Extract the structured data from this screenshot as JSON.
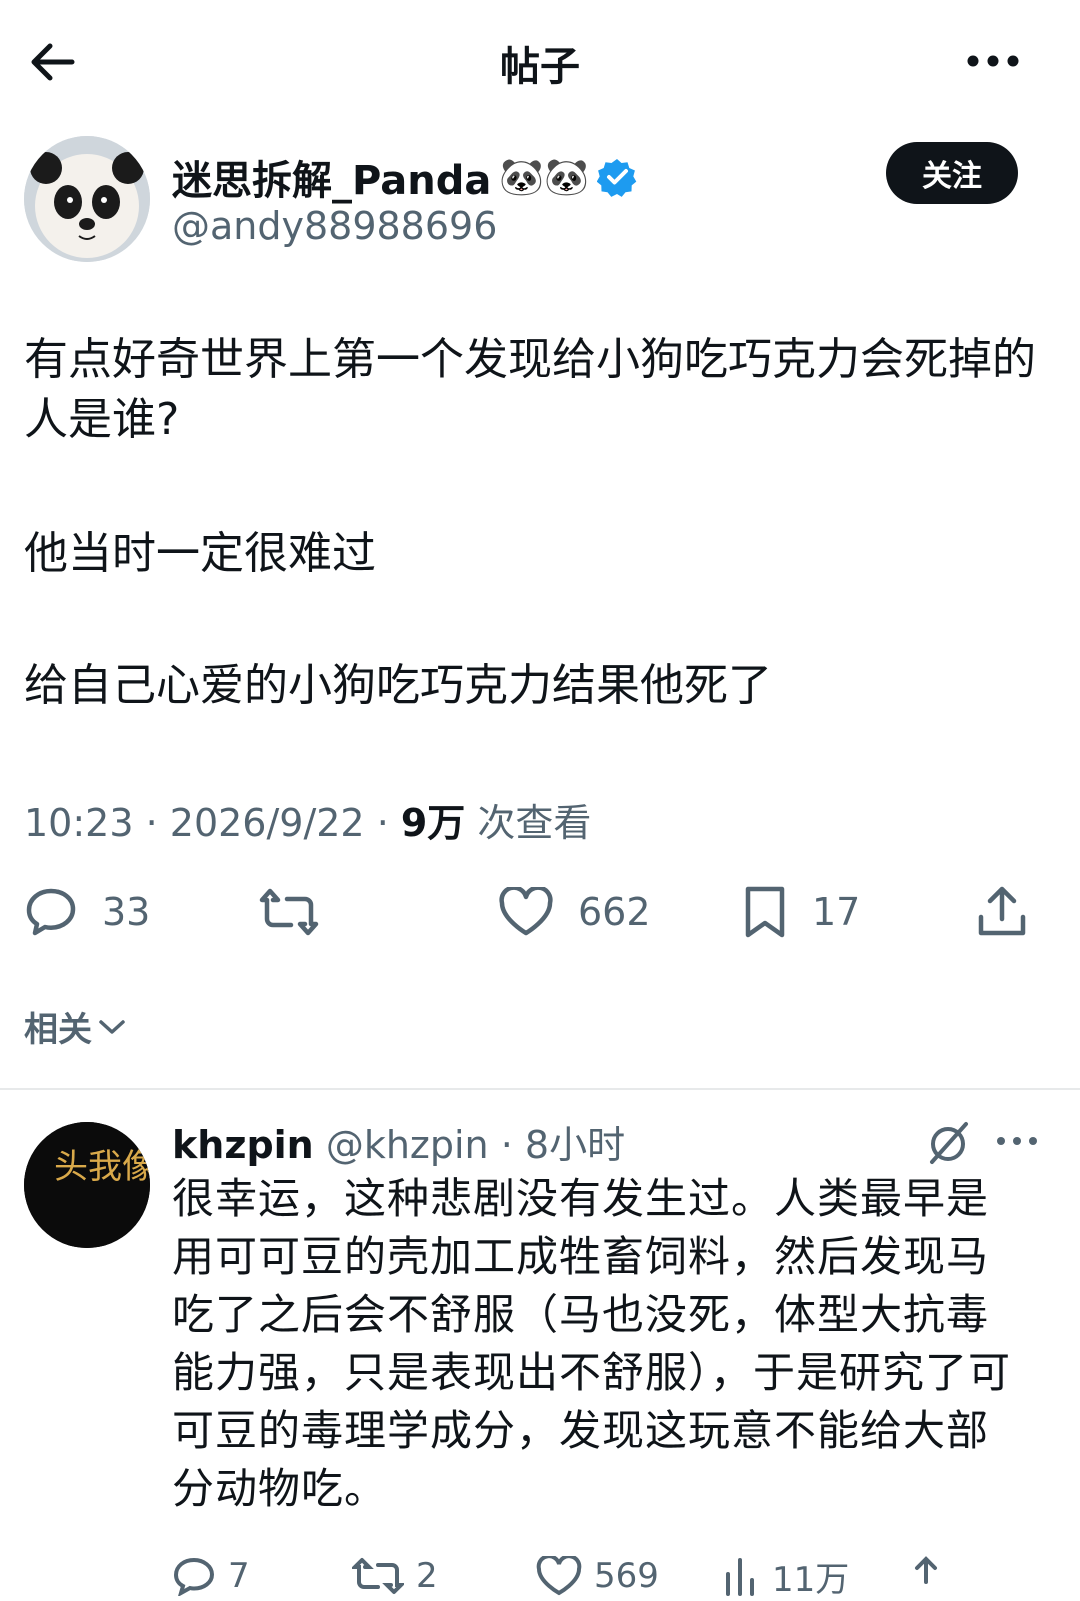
{
  "header": {
    "title": "帖子",
    "back_icon": "arrow-left-icon",
    "more_icon": "ellipsis-icon"
  },
  "post": {
    "author_name": "迷思拆解_Panda",
    "author_emojis": "🐼🐼",
    "author_handle": "@andy88988696",
    "follow_label": "关注",
    "paragraphs": [
      "有点好奇世界上第一个发现给小狗吃巧克力会死掉的人是谁?",
      "他当时一定很难过",
      "给自己心爱的小狗吃巧克力结果他死了"
    ],
    "time": "10:23",
    "date": "2026/9/22",
    "views_count": "9万",
    "views_label": "次查看",
    "replies": "33",
    "likes": "662",
    "bookmarks": "17"
  },
  "related_label": "相关",
  "reply": {
    "name": "khzpin",
    "handle": "@khzpin",
    "time": "8小时",
    "avatar_text": "头我像是",
    "text": "很幸运，这种悲剧没有发生过。人类最早是用可可豆的壳加工成牲畜饲料，然后发现马吃了之后会不舒服（马也没死，体型大抗毒能力强，只是表现出不舒服），于是研究了可可豆的毒理学成分，发现这玩意不能给大部分动物吃。",
    "replies": "7",
    "retweets": "2",
    "likes": "569",
    "views": "11万"
  },
  "colors": {
    "primary_text": "#0f1419",
    "secondary_text": "#536471",
    "verified": "#1d9bf0",
    "divider": "#e7e9ea"
  }
}
